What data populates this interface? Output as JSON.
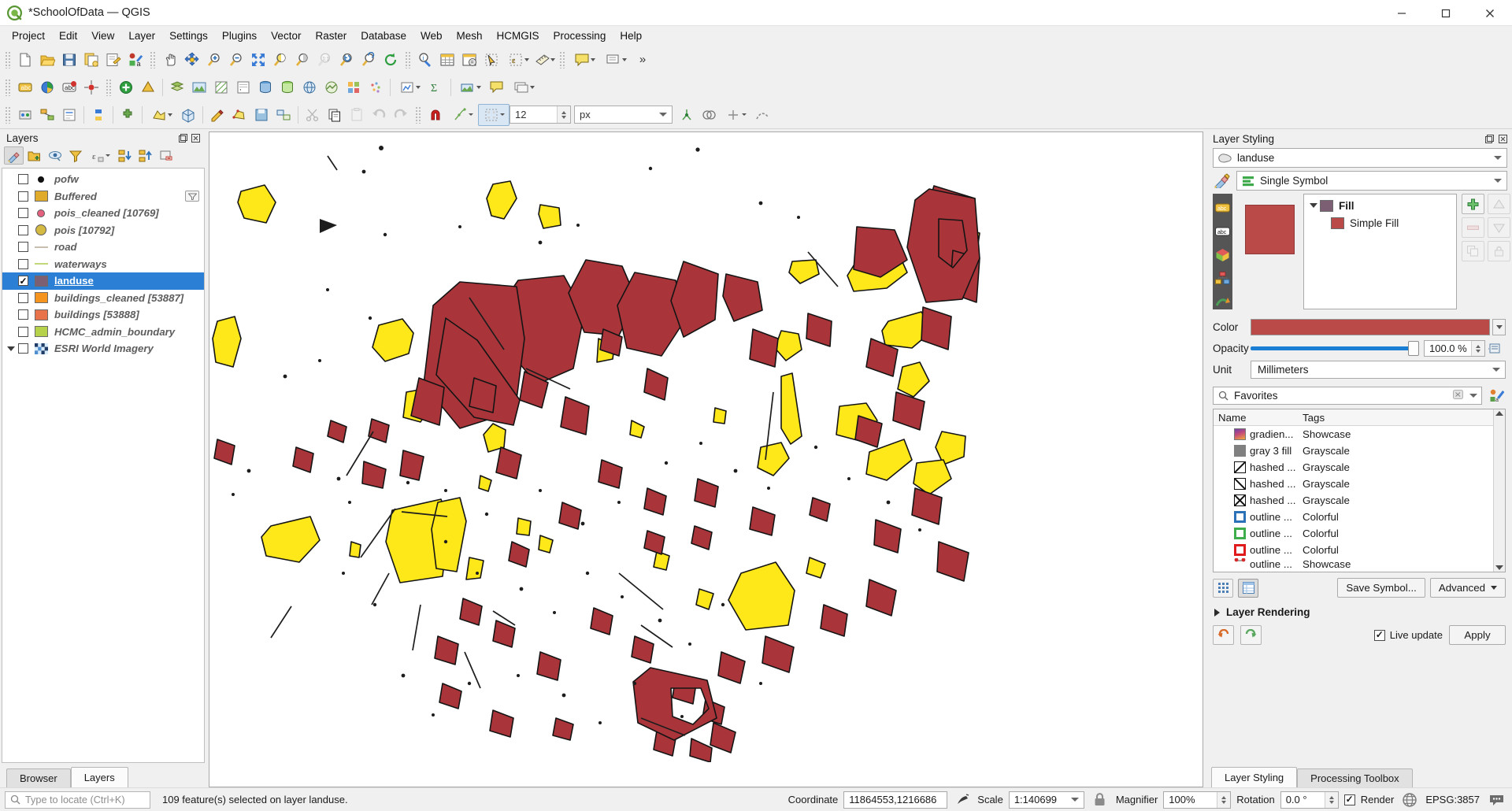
{
  "window": {
    "title": "*SchoolOfData — QGIS",
    "logo_icon": "qgis-logo-icon",
    "minimize_label": "—",
    "maximize_label": "□",
    "close_label": "✕"
  },
  "menubar": {
    "items": [
      {
        "label": "Project"
      },
      {
        "label": "Edit"
      },
      {
        "label": "View"
      },
      {
        "label": "Layer"
      },
      {
        "label": "Settings"
      },
      {
        "label": "Plugins"
      },
      {
        "label": "Vector"
      },
      {
        "label": "Raster"
      },
      {
        "label": "Database"
      },
      {
        "label": "Web"
      },
      {
        "label": "Mesh"
      },
      {
        "label": "HCMGIS"
      },
      {
        "label": "Processing"
      },
      {
        "label": "Help"
      }
    ]
  },
  "toolbar": {
    "overflow_label": "»",
    "size_value": "12",
    "unit_value": "px"
  },
  "layers_panel": {
    "title": "Layers",
    "dock_buttons": [
      "undock-icon",
      "close-icon"
    ],
    "toolbar_buttons": [
      "open-layer-styling-panel-icon",
      "add-group-icon",
      "manage-map-themes-icon",
      "filter-legend-icon",
      "filter-legend-expression-icon",
      "expand-all-icon",
      "collapse-all-icon",
      "remove-layer-icon"
    ],
    "layers": [
      {
        "name": "pofw",
        "checked": false,
        "symbol": "dot",
        "color": "#111111",
        "expander": false,
        "badge": false
      },
      {
        "name": "Buffered",
        "checked": false,
        "symbol": "box",
        "color": "#e0aa2a",
        "expander": false,
        "badge": true
      },
      {
        "name": "pois_cleaned [10769]",
        "checked": false,
        "symbol": "dot",
        "color": "#e4607f",
        "expander": false,
        "badge": false
      },
      {
        "name": "pois [10792]",
        "checked": false,
        "symbol": "bigdot",
        "color": "#d4b942",
        "expander": false,
        "badge": false
      },
      {
        "name": "road",
        "checked": false,
        "symbol": "line",
        "color": "#c9bfb0",
        "expander": false,
        "badge": false
      },
      {
        "name": "waterways",
        "checked": false,
        "symbol": "line",
        "color": "#c2d67a",
        "expander": false,
        "badge": false
      },
      {
        "name": "landuse",
        "checked": true,
        "symbol": "box",
        "color": "#7d5f73",
        "expander": false,
        "badge": false,
        "selected": true
      },
      {
        "name": "buildings_cleaned [53887]",
        "checked": false,
        "symbol": "box",
        "color": "#f5941f",
        "expander": false,
        "badge": false
      },
      {
        "name": "buildings [53888]",
        "checked": false,
        "symbol": "box",
        "color": "#e8724a",
        "expander": false,
        "badge": false
      },
      {
        "name": "HCMC_admin_boundary",
        "checked": false,
        "symbol": "box",
        "color": "#b5d24a",
        "expander": false,
        "badge": false
      },
      {
        "name": "ESRI World Imagery",
        "checked": false,
        "symbol": "raster",
        "color": "#3b7fc4",
        "expander": true,
        "badge": false
      }
    ],
    "tabs": [
      {
        "label": "Browser",
        "active": false
      },
      {
        "label": "Layers",
        "active": true
      }
    ]
  },
  "layer_styling": {
    "title": "Layer Styling",
    "layer_name": "landuse",
    "layer_icon": "polygon-layer-icon",
    "renderer": "Single Symbol",
    "renderer_icon": "single-symbol-icon",
    "vertical_tabs": [
      "symbology-icon",
      "labels-icon",
      "masks-icon",
      "3d-view-icon",
      "diagrams-icon",
      "history-icon"
    ],
    "symbol_tree": [
      {
        "label": "Fill",
        "swatch": "#7d5f73",
        "bold": true,
        "child": false
      },
      {
        "label": "Simple Fill",
        "swatch": "#b94a48",
        "bold": false,
        "child": true
      }
    ],
    "symbol_buttons": [
      "add-symbol-layer-icon",
      "move-up-icon",
      "remove-symbol-layer-icon",
      "move-down-icon",
      "duplicate-icon",
      "lock-icon"
    ],
    "properties": {
      "color_label": "Color",
      "color_value": "#b94a48",
      "opacity_label": "Opacity",
      "opacity_value": "100.0 %",
      "unit_label": "Unit",
      "unit_value": "Millimeters"
    },
    "symbol_search": {
      "placeholder": "Favorites",
      "value": "Favorites",
      "search_icon": "search-icon",
      "clear_icon": "clear-icon"
    },
    "symbol_table": {
      "columns": [
        "Name",
        "Tags"
      ],
      "rows": [
        {
          "name": "gradien...",
          "tag": "Showcase",
          "swatch": "gradient",
          "color": "#e8a13c"
        },
        {
          "name": "gray 3 fill",
          "tag": "Grayscale",
          "swatch": "solid",
          "color": "#808080"
        },
        {
          "name": "hashed ...",
          "tag": "Grayscale",
          "swatch": "hash-fwd",
          "color": "#ffffff"
        },
        {
          "name": "hashed ...",
          "tag": "Grayscale",
          "swatch": "hash-back",
          "color": "#ffffff"
        },
        {
          "name": "hashed ...",
          "tag": "Grayscale",
          "swatch": "hash-cross",
          "color": "#ffffff"
        },
        {
          "name": "outline ...",
          "tag": "Colorful",
          "swatch": "outline",
          "color": "#2a71b8"
        },
        {
          "name": "outline ...",
          "tag": "Colorful",
          "swatch": "outline",
          "color": "#3ead4b"
        },
        {
          "name": "outline ...",
          "tag": "Colorful",
          "swatch": "outline",
          "color": "#e01b1b"
        },
        {
          "name": "outline ...",
          "tag": "Showcase",
          "swatch": "marker",
          "color": "#d42a2a"
        }
      ]
    },
    "footer": {
      "save_symbol_label": "Save Symbol...",
      "advanced_label": "Advanced",
      "layer_rendering_label": "Layer Rendering",
      "live_update_label": "Live update",
      "live_update_checked": true,
      "apply_label": "Apply",
      "undo_icon": "undo-icon",
      "redo_icon": "redo-icon"
    },
    "tabs": [
      {
        "label": "Layer Styling",
        "active": true
      },
      {
        "label": "Processing Toolbox",
        "active": false
      }
    ]
  },
  "statusbar": {
    "locator_placeholder": "Type to locate (Ctrl+K)",
    "message": "109 feature(s) selected on layer landuse.",
    "coordinate_label": "Coordinate",
    "coordinate_value": "11864553,1216686",
    "scale_label": "Scale",
    "scale_value": "1:140699",
    "magnifier_label": "Magnifier",
    "magnifier_value": "100%",
    "rotation_label": "Rotation",
    "rotation_value": "0.0 °",
    "render_label": "Render",
    "render_checked": true,
    "crs_label": "EPSG:3857",
    "lock_icon": "lock-icon",
    "globe_icon": "globe-icon",
    "messages_icon": "messages-icon"
  },
  "map": {
    "background": "#ffffff",
    "fill_red": "#a9353a",
    "fill_yellow": "#ffe81a",
    "stroke": "#141414"
  }
}
